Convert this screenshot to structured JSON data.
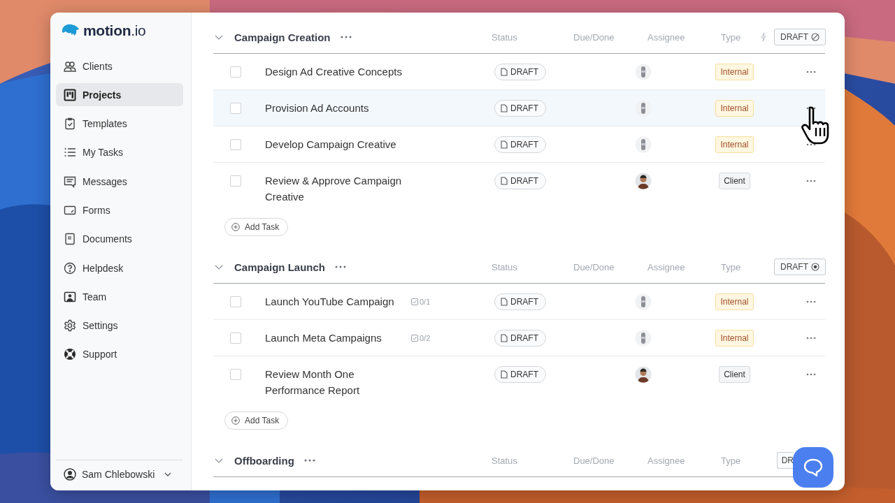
{
  "app": {
    "logo": "**motion**.io"
  },
  "sidebar": {
    "items": [
      {
        "label": "Clients",
        "selected": false
      },
      {
        "label": "Projects",
        "selected": true
      },
      {
        "label": "Templates",
        "selected": false
      },
      {
        "label": "My Tasks",
        "selected": false
      },
      {
        "label": "Messages",
        "selected": false
      },
      {
        "label": "Forms",
        "selected": false
      },
      {
        "label": "Documents",
        "selected": false
      },
      {
        "label": "Helpdesk",
        "selected": false
      },
      {
        "label": "Team",
        "selected": false
      },
      {
        "label": "Settings",
        "selected": false
      },
      {
        "label": "Support",
        "selected": false
      }
    ],
    "user": {
      "name": "Sam Chlebowski"
    }
  },
  "sections": [
    {
      "title": "Campaign Creation",
      "columns": [
        "Status",
        "Due/Done",
        "Assignee",
        "Type"
      ],
      "automation": true,
      "badge": {
        "label": "DRAFT",
        "kind": "disabled"
      },
      "add_label": "Add Task",
      "tasks": [
        {
          "name": "Design Ad Creative Concepts",
          "checked": false,
          "hovered": false,
          "status": "DRAFT",
          "assignee": {
            "kind": "placeholder"
          },
          "type": {
            "label": "Internal",
            "kind": "internal"
          }
        },
        {
          "name": "Provision Ad Accounts",
          "checked": false,
          "hovered": true,
          "status": "DRAFT",
          "assignee": {
            "kind": "placeholder"
          },
          "type": {
            "label": "Internal",
            "kind": "internal"
          }
        },
        {
          "name": "Develop Campaign Creative",
          "checked": false,
          "hovered": false,
          "status": "DRAFT",
          "assignee": {
            "kind": "placeholder"
          },
          "type": {
            "label": "Internal",
            "kind": "internal"
          }
        },
        {
          "name": "Review & Approve Campaign Creative",
          "checked": false,
          "hovered": false,
          "status": "DRAFT",
          "type": {
            "label": "Client",
            "kind": "client"
          }
        }
      ]
    },
    {
      "title": "Campaign Launch",
      "columns": [
        "Status",
        "Due/Done",
        "Assignee",
        "Type"
      ],
      "automation": false,
      "badge": {
        "label": "DRAFT",
        "kind": "active"
      },
      "add_label": "Add Task",
      "tasks": [
        {
          "name": "Launch YouTube Campaign",
          "checked": false,
          "hovered": false,
          "subtasks": "0/1",
          "status": "DRAFT",
          "assignee": {
            "kind": "placeholder"
          },
          "type": {
            "label": "Internal",
            "kind": "internal"
          }
        },
        {
          "name": "Launch Meta Campaigns",
          "checked": false,
          "hovered": false,
          "subtasks": "0/2",
          "status": "DRAFT",
          "assignee": {
            "kind": "placeholder"
          },
          "type": {
            "label": "Internal",
            "kind": "internal"
          }
        },
        {
          "name": "Review Month One Performance Report",
          "checked": false,
          "hovered": false,
          "status": "DRAFT",
          "type": {
            "label": "Client",
            "kind": "client"
          }
        }
      ]
    },
    {
      "title": "Offboarding",
      "columns": [
        "Status",
        "Due/Done",
        "Assignee",
        "Type"
      ],
      "automation": false,
      "badge": {
        "label": "DR",
        "kind": "cut"
      }
    }
  ]
}
